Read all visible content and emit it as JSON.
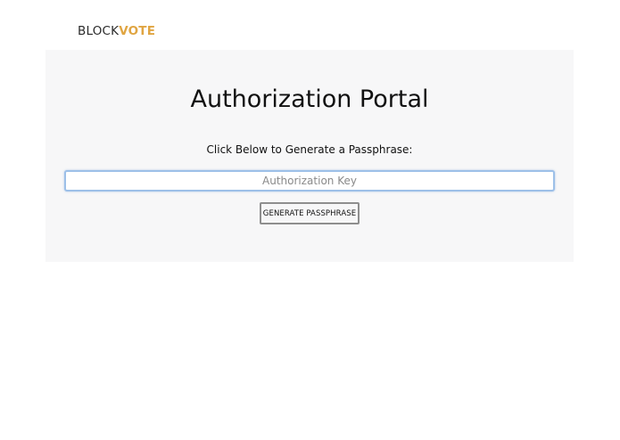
{
  "brand": {
    "part1": "BLOCK",
    "part2": "VOTE",
    "accent_color": "#e0a542"
  },
  "portal": {
    "title": "Authorization Portal",
    "instruction": "Click Below to Generate a Passphrase:",
    "key_input": {
      "value": "",
      "placeholder": "Authorization Key"
    },
    "generate_button_label": "GENERATE PASSPHRASE"
  }
}
